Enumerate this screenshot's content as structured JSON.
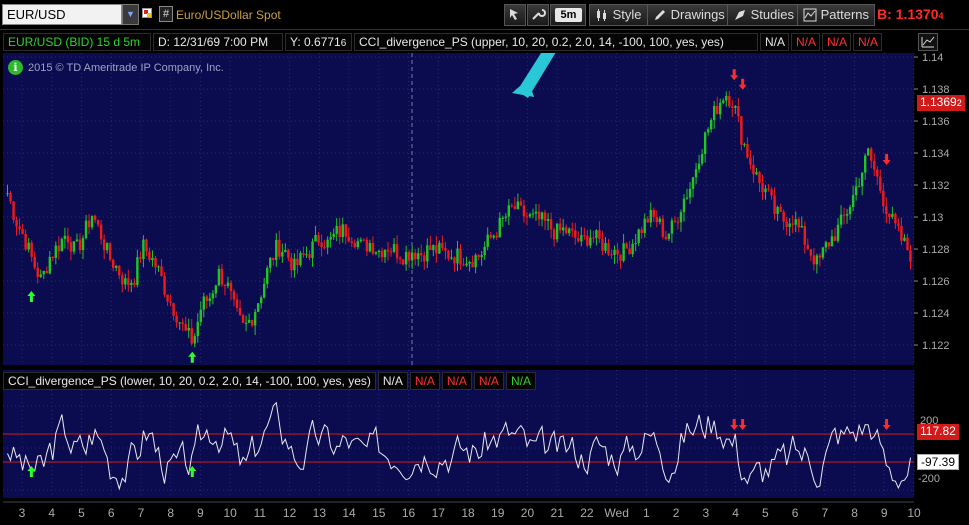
{
  "toolbar": {
    "symbol": "EUR/USD",
    "description": "Euro/USDollar Spot",
    "hash_label": "#",
    "timeframe": "5m",
    "style_label": "Style",
    "drawings_label": "Drawings",
    "studies_label": "Studies",
    "patterns_label": "Patterns",
    "bid_label": "B: 1.1370",
    "bid_suffix": "4"
  },
  "header": {
    "instrument": "EUR/USD (BID) 15 d 5m",
    "date": "D: 12/31/69 7:00 PM",
    "y_value": "Y: 0.6771",
    "y_suffix": "6",
    "study": "CCI_divergence_PS (upper, 10, 20, 0.2, 2.0, 14, -100, 100, yes, yes)",
    "na_values": [
      "N/A",
      "N/A",
      "N/A",
      "N/A"
    ]
  },
  "upper_panel": {
    "copyright": "2015 © TD Ameritrade IP Company, Inc.",
    "price_labels": [
      "1.14",
      "1.138",
      "1.136",
      "1.134",
      "1.132",
      "1.13",
      "1.128",
      "1.126",
      "1.124",
      "1.122"
    ],
    "current_price": "1.1369",
    "current_price_suffix": "2"
  },
  "lower_panel": {
    "study": "CCI_divergence_PS (lower, 10, 20, 0.2, 2.0, 14, -100, 100, yes, yes)",
    "na_values": [
      "N/A",
      "N/A",
      "N/A",
      "N/A",
      "N/A"
    ],
    "axis_labels": [
      "200",
      "-200"
    ],
    "upper_tag": "117.82",
    "lower_tag": "-97.39"
  },
  "xaxis": {
    "labels": [
      "3",
      "4",
      "5",
      "6",
      "7",
      "8",
      "9",
      "10",
      "11",
      "12",
      "13",
      "14",
      "15",
      "16",
      "17",
      "18",
      "19",
      "20",
      "21",
      "22",
      "Wed",
      "1",
      "2",
      "3",
      "4",
      "5",
      "6",
      "7",
      "8",
      "9",
      "10"
    ]
  },
  "colors": {
    "panel_bg": "#0b0b4f",
    "grid": "#2a2a78",
    "up_candle": "#23c423",
    "down_candle": "#ee1b1b",
    "cci_line": "#e8e8f0",
    "level_line": "#d41a1a",
    "price_tag": "#d11a1a"
  },
  "chart_data": {
    "type": "candlestick",
    "ylim": [
      1.121,
      1.14
    ],
    "close_path": [
      1.1315,
      1.1298,
      1.1287,
      1.1272,
      1.126,
      1.1275,
      1.1282,
      1.129,
      1.1278,
      1.1288,
      1.1302,
      1.129,
      1.1275,
      1.1268,
      1.1258,
      1.1262,
      1.1282,
      1.1275,
      1.1265,
      1.125,
      1.124,
      1.1228,
      1.1222,
      1.1245,
      1.125,
      1.1265,
      1.1258,
      1.124,
      1.123,
      1.1238,
      1.1252,
      1.127,
      1.1282,
      1.1278,
      1.1268,
      1.1275,
      1.128,
      1.1288,
      1.1283,
      1.129,
      1.1292,
      1.1288,
      1.1281,
      1.1284,
      1.1279,
      1.1282,
      1.1279,
      1.1276,
      1.1279,
      1.1277,
      1.128,
      1.1279,
      1.1277,
      1.1276,
      1.1275,
      1.1274,
      1.1276,
      1.1285,
      1.1292,
      1.13,
      1.1306,
      1.1302,
      1.1299,
      1.1298,
      1.1295,
      1.129,
      1.1292,
      1.1288,
      1.1284,
      1.1289,
      1.1285,
      1.1281,
      1.1279,
      1.1278,
      1.1284,
      1.1292,
      1.13,
      1.1298,
      1.1288,
      1.1295,
      1.131,
      1.132,
      1.134,
      1.1355,
      1.1368,
      1.1378,
      1.1372,
      1.135,
      1.1335,
      1.1322,
      1.1315,
      1.1302,
      1.1298,
      1.13,
      1.129,
      1.128,
      1.127,
      1.1282,
      1.1289,
      1.1298,
      1.131,
      1.1325,
      1.134,
      1.1325,
      1.1308,
      1.1295,
      1.1285,
      1.1277
    ],
    "up_arrows_at": [
      3,
      22
    ],
    "down_arrows_at": [
      86,
      87,
      104
    ],
    "cci": {
      "levels": [
        100,
        -100
      ],
      "axis": [
        200,
        -200
      ],
      "current": 117.82,
      "lower_reference": -97.39
    }
  }
}
